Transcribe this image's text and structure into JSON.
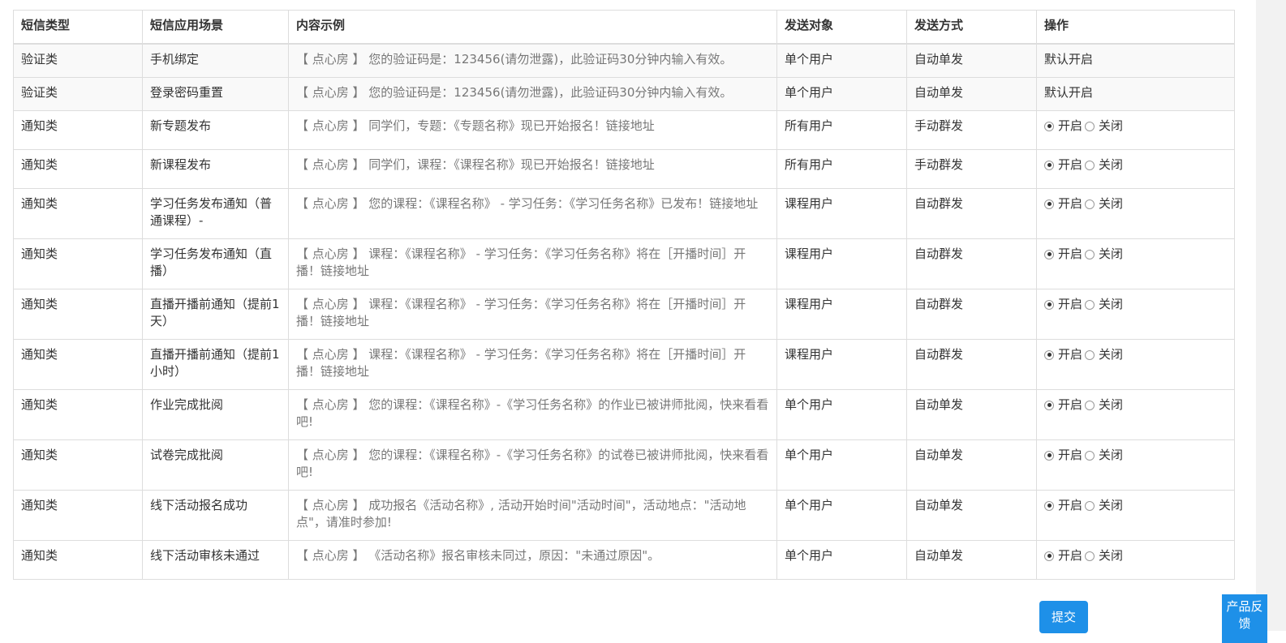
{
  "table": {
    "headers": [
      "短信类型",
      "短信应用场景",
      "内容示例",
      "发送对象",
      "发送方式",
      "操作"
    ],
    "rows": [
      {
        "type": "验证类",
        "scene": "手机绑定",
        "example": "【 点心房 】 您的验证码是：123456(请勿泄露)，此验证码30分钟内输入有效。",
        "target": "单个用户",
        "method": "自动单发",
        "op_text": "默认开启"
      },
      {
        "type": "验证类",
        "scene": "登录密码重置",
        "example": "【 点心房 】 您的验证码是：123456(请勿泄露)，此验证码30分钟内输入有效。",
        "target": "单个用户",
        "method": "自动单发",
        "op_text": "默认开启"
      },
      {
        "type": "通知类",
        "scene": "新专题发布",
        "example": "【 点心房 】 同学们，专题：《专题名称》现已开始报名！链接地址",
        "target": "所有用户",
        "method": "手动群发",
        "selected": "开启"
      },
      {
        "type": "通知类",
        "scene": "新课程发布",
        "example": "【 点心房 】 同学们，课程：《课程名称》现已开始报名！链接地址",
        "target": "所有用户",
        "method": "手动群发",
        "selected": "开启"
      },
      {
        "type": "通知类",
        "scene": "学习任务发布通知（普通课程）-",
        "example": "【 点心房 】 您的课程：《课程名称》 - 学习任务：《学习任务名称》已发布！链接地址",
        "target": "课程用户",
        "method": "自动群发",
        "selected": "开启"
      },
      {
        "type": "通知类",
        "scene": "学习任务发布通知（直播）",
        "example": "【 点心房 】 课程：《课程名称》 - 学习任务：《学习任务名称》将在［开播时间］开播！链接地址",
        "target": "课程用户",
        "method": "自动群发",
        "selected": "开启"
      },
      {
        "type": "通知类",
        "scene": "直播开播前通知（提前1天）",
        "example": "【 点心房 】 课程：《课程名称》 - 学习任务：《学习任务名称》将在［开播时间］开播！链接地址",
        "target": "课程用户",
        "method": "自动群发",
        "selected": "开启"
      },
      {
        "type": "通知类",
        "scene": "直播开播前通知（提前1小时）",
        "example": "【 点心房 】 课程：《课程名称》 - 学习任务：《学习任务名称》将在［开播时间］开播！链接地址",
        "target": "课程用户",
        "method": "自动群发",
        "selected": "开启"
      },
      {
        "type": "通知类",
        "scene": "作业完成批阅",
        "example": "【 点心房 】 您的课程：《课程名称》-《学习任务名称》的作业已被讲师批阅，快来看看吧!",
        "target": "单个用户",
        "method": "自动单发",
        "selected": "开启"
      },
      {
        "type": "通知类",
        "scene": "试卷完成批阅",
        "example": "【 点心房 】 您的课程：《课程名称》-《学习任务名称》的试卷已被讲师批阅，快来看看吧!",
        "target": "单个用户",
        "method": "自动单发",
        "selected": "开启"
      },
      {
        "type": "通知类",
        "scene": "线下活动报名成功",
        "example": "【 点心房 】 成功报名《活动名称》, 活动开始时间\"活动时间\"，活动地点：\"活动地点\"，请准时参加!",
        "target": "单个用户",
        "method": "自动单发",
        "selected": "开启"
      },
      {
        "type": "通知类",
        "scene": "线下活动审核未通过",
        "example": "【 点心房 】 《活动名称》报名审核未同过，原因：\"未通过原因\"。",
        "target": "单个用户",
        "method": "自动单发",
        "selected": "开启"
      }
    ],
    "radio_labels": {
      "on": "开启",
      "off": "关闭"
    }
  },
  "actions": {
    "submit_label": "提交"
  },
  "feedback": {
    "label": "产品反馈"
  },
  "colors": {
    "accent": "#1e90e8",
    "stripe": "#f9f9f9",
    "border": "#dddddd"
  }
}
